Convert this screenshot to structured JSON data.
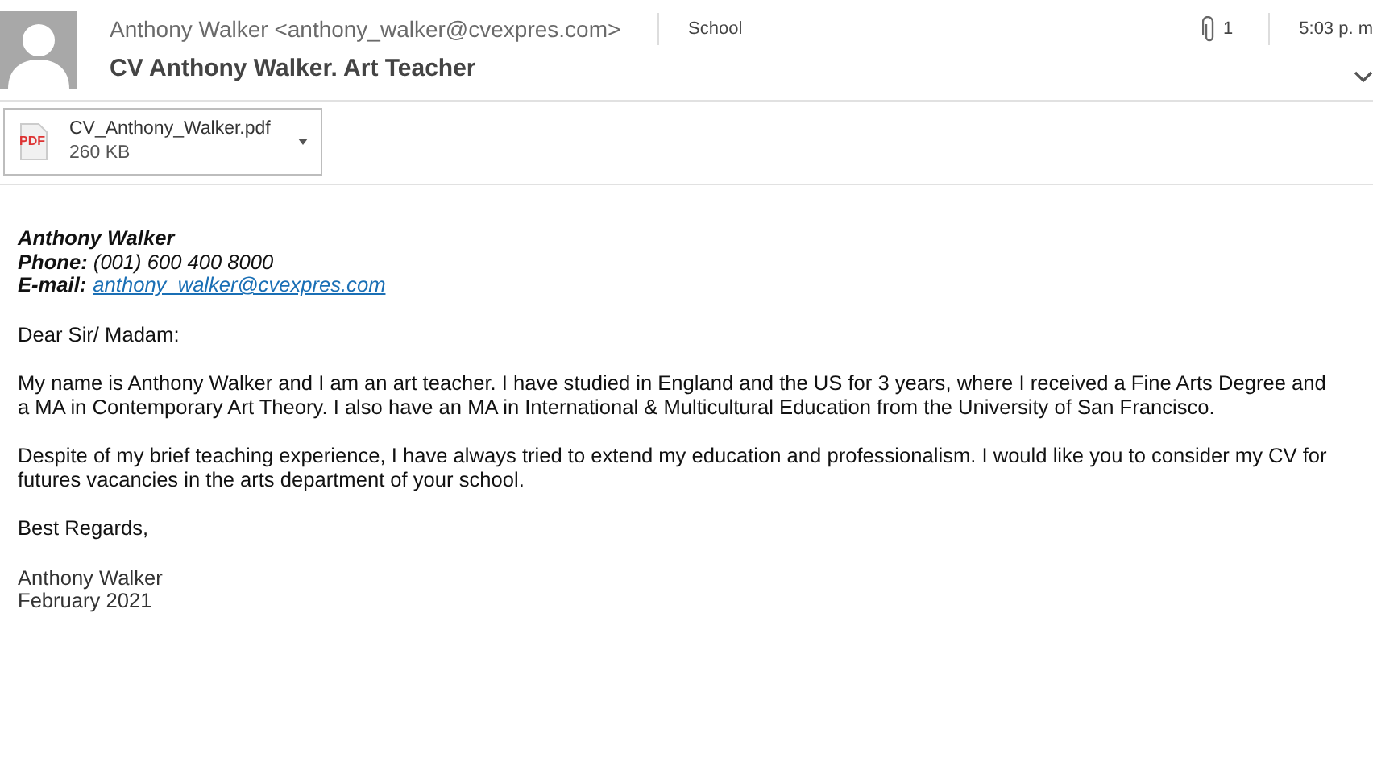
{
  "header": {
    "sender": "Anthony Walker <anthony_walker@cvexpres.com>",
    "category": "School",
    "attachment_count": "1",
    "time": "5:03 p. m",
    "subject": "CV Anthony Walker. Art Teacher"
  },
  "attachments": [
    {
      "name": "CV_Anthony_Walker.pdf",
      "size": "260 KB",
      "type_label": "PDF"
    }
  ],
  "signature": {
    "name": "Anthony Walker",
    "phone": "**Phone:** (001) 600 400 8000",
    "email_label": "**E-mail:**",
    "email": "anthony_walker@cvexpres.com"
  },
  "body": [
    {
      "kind": "paragraph",
      "text": "Dear Sir/ Madam:"
    },
    {
      "kind": "paragraph",
      "text": "My name is Anthony Walker and I am an art teacher. I have studied in England and the US for 3 years, where I received a Fine Arts Degree and a MA in Contemporary Art Theory. I also have an MA in International & Multicultural Education from the University of San Francisco."
    },
    {
      "kind": "paragraph",
      "text": "Despite of my brief teaching experience, I have always tried to extend my education and professionalism. I would like you to consider my CV for futures vacancies in the arts department of your school."
    },
    {
      "kind": "paragraph",
      "text": "Best Regards,"
    },
    {
      "kind": "closing",
      "lines": [
        "Anthony Walker",
        "February 2021"
      ]
    }
  ]
}
